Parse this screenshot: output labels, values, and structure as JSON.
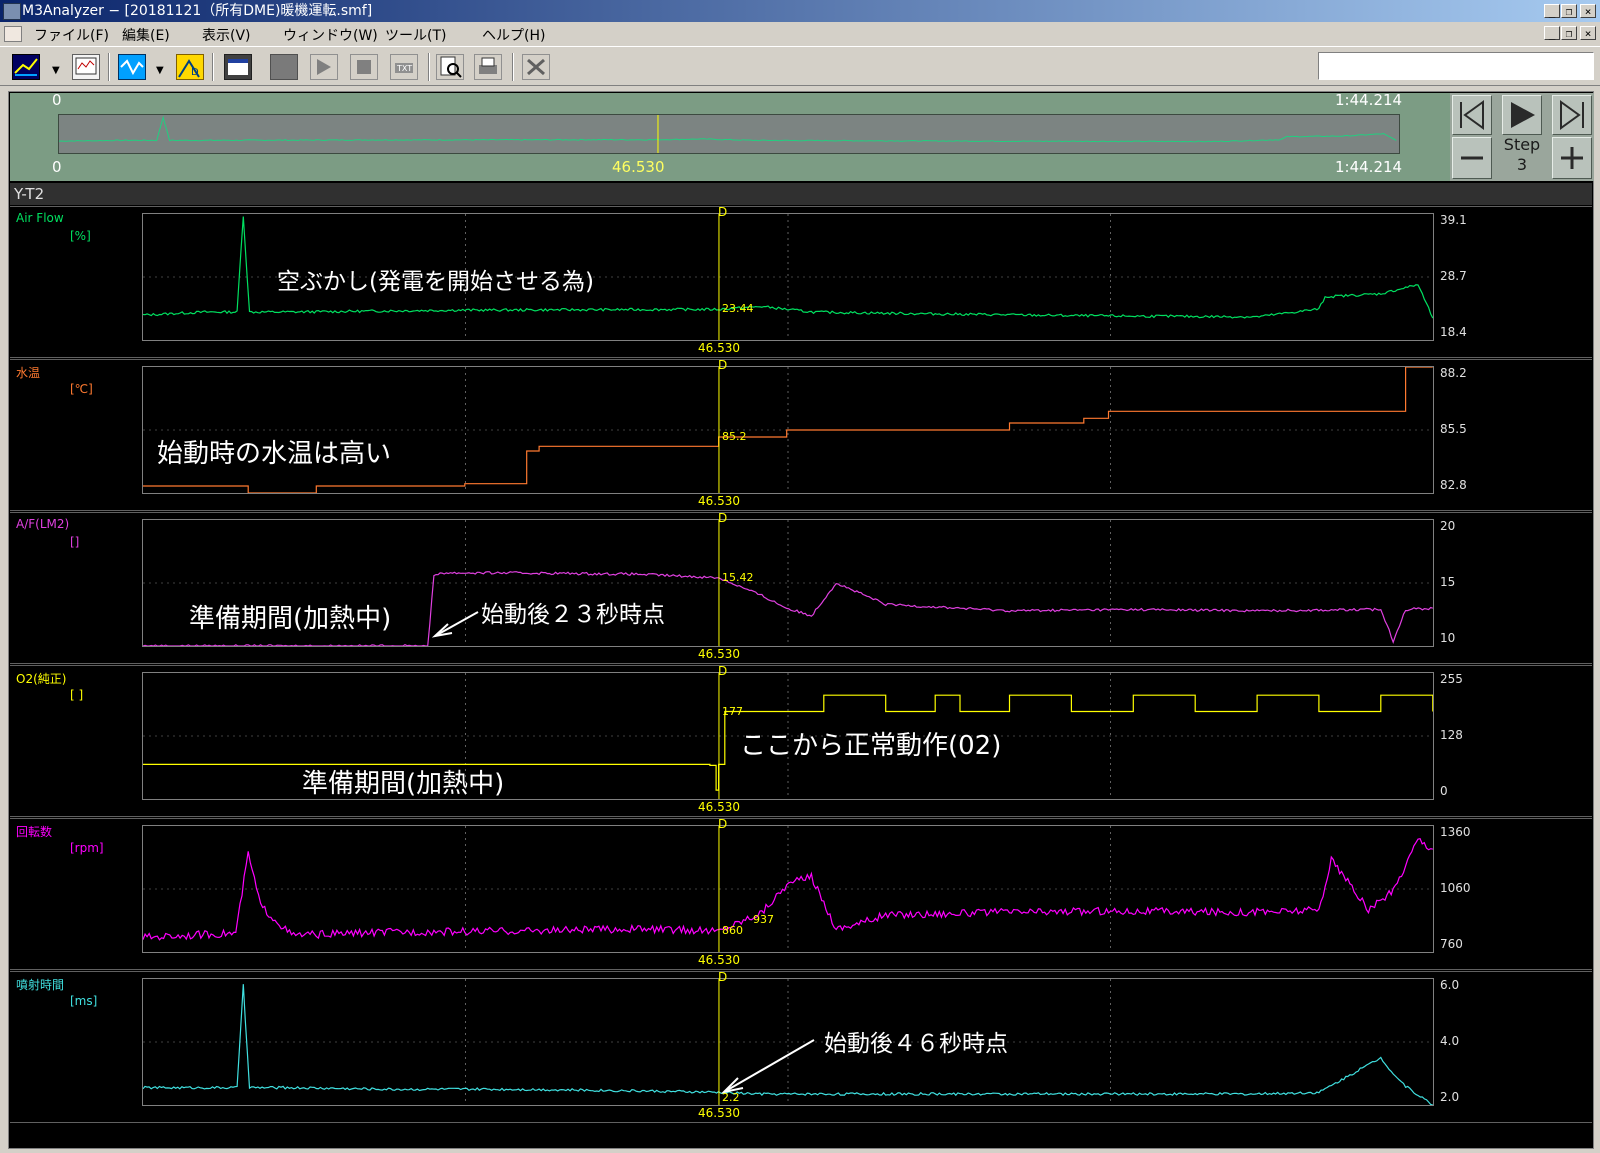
{
  "window": {
    "title": "M3Analyzer − [20181121（所有DME)暖機運転.smf]",
    "controls": [
      "_",
      "❐",
      "×"
    ]
  },
  "menu": {
    "items": [
      "ファイル(F)",
      "編集(E)",
      "表示(V)",
      "ウィンドウ(W)",
      "ツール(T)",
      "ヘルプ(H)"
    ],
    "child_controls": [
      "_",
      "❐",
      "×"
    ]
  },
  "overview": {
    "start_top": "0",
    "end_top": "1:44.214",
    "start_bottom": "0",
    "cursor_time": "46.530",
    "end_bottom": "1:44.214",
    "cursor_fraction": 0.447
  },
  "controls": {
    "step_label": "Step",
    "step_value": "3"
  },
  "view": {
    "name": "Y-T2",
    "cursor_marker": "D",
    "cursor_time": "46.530"
  },
  "panels": [
    {
      "label": "Air Flow",
      "unit": "[%]",
      "color": "#00e060",
      "scale": [
        "39.1",
        "28.7",
        "18.4"
      ],
      "cursor_value": "23.44",
      "annotation": "空ぶかし(発電を開始させる為)"
    },
    {
      "label": "水温",
      "unit": "[℃]",
      "color": "#ff7a30",
      "scale": [
        "88.2",
        "85.5",
        "82.8"
      ],
      "cursor_value": "85.2",
      "annotation": "始動時の水温は高い"
    },
    {
      "label": "A/F(LM2)",
      "unit": "[]",
      "color": "#e040e0",
      "scale": [
        "20",
        "15",
        "10"
      ],
      "cursor_value": "15.42",
      "annotation": "準備期間(加熱中)",
      "annotation2": "始動後２３秒時点"
    },
    {
      "label": "O2(純正)",
      "unit": "[ ]",
      "color": "#ffff00",
      "scale": [
        "255",
        "128",
        "0"
      ],
      "cursor_value": "177",
      "annotation": "準備期間(加熱中)",
      "annotation2": "ここから正常動作(02)"
    },
    {
      "label": "回転数",
      "unit": "[rpm]",
      "color": "#ff00ff",
      "scale": [
        "1360",
        "1060",
        "760"
      ],
      "cursor_value": "860",
      "extra_value": "937"
    },
    {
      "label": "噴射時間",
      "unit": "[ms]",
      "color": "#40e0e0",
      "scale": [
        "6.0",
        "4.0",
        "2.0"
      ],
      "cursor_value": "2.2",
      "annotation": "始動後４６秒時点"
    }
  ],
  "chart_data": {
    "type": "line",
    "x_range_seconds": [
      0,
      104.214
    ],
    "cursor_x": 46.53,
    "series": [
      {
        "name": "Air Flow",
        "unit": "%",
        "ylim": [
          18.4,
          39.1
        ],
        "x": [
          0,
          5,
          7.6,
          8.1,
          8.6,
          12,
          25,
          40,
          46.5,
          50,
          54,
          60,
          75,
          90,
          95,
          95.5,
          100,
          103,
          104.2
        ],
        "y": [
          22.5,
          23.0,
          23.0,
          38.9,
          23.0,
          23.0,
          23.3,
          23.4,
          23.44,
          23.9,
          23.0,
          22.8,
          22.4,
          22.2,
          23.5,
          25.5,
          26.0,
          27.5,
          22.0
        ]
      },
      {
        "name": "水温",
        "unit": "℃",
        "ylim": [
          82.8,
          88.2
        ],
        "x": [
          0,
          7.5,
          8.5,
          11,
          14,
          15.5,
          26,
          31,
          32,
          46.5,
          52,
          60,
          70,
          76,
          78,
          100,
          102,
          104.2
        ],
        "y": [
          83.1,
          83.1,
          82.8,
          82.8,
          83.1,
          83.1,
          83.2,
          84.6,
          84.8,
          85.2,
          85.5,
          85.5,
          85.8,
          86.0,
          86.3,
          86.3,
          88.2,
          88.2
        ]
      },
      {
        "name": "A/F(LM2)",
        "unit": "",
        "ylim": [
          10,
          20
        ],
        "x": [
          0,
          23,
          23.5,
          24,
          30,
          40,
          46.5,
          50,
          52,
          54,
          56,
          60,
          70,
          80,
          90,
          100,
          101,
          102,
          104.2
        ],
        "y": [
          10,
          10,
          15.5,
          15.8,
          15.8,
          15.7,
          15.42,
          14,
          13,
          12.4,
          15,
          13.3,
          12.8,
          12.9,
          12.8,
          12.9,
          10.4,
          12.9,
          13.0
        ]
      },
      {
        "name": "O2(純正)",
        "unit": "",
        "ylim": [
          0,
          255
        ],
        "x": [
          0,
          45,
          45.8,
          46.3,
          46.5,
          47,
          52,
          55,
          60,
          64,
          66,
          70,
          75,
          80,
          85,
          90,
          95,
          100,
          104.2
        ],
        "y": [
          70,
          70,
          68,
          18,
          70,
          177,
          177,
          210,
          177,
          210,
          177,
          210,
          177,
          210,
          177,
          210,
          177,
          210,
          177
        ]
      },
      {
        "name": "回転数",
        "unit": "rpm",
        "ylim": [
          760,
          1360
        ],
        "x": [
          0,
          7.5,
          8.5,
          9.5,
          12,
          20,
          30,
          40,
          46.5,
          50,
          52,
          54,
          56,
          58,
          60,
          70,
          80,
          90,
          95,
          96,
          99,
          101,
          103,
          104.2
        ],
        "y": [
          830,
          850,
          1230,
          980,
          840,
          855,
          860,
          870,
          860,
          950,
          1080,
          1120,
          870,
          900,
          937,
          950,
          955,
          950,
          960,
          1200,
          960,
          1050,
          1300,
          1250
        ]
      },
      {
        "name": "噴射時間",
        "unit": "ms",
        "ylim": [
          2.0,
          6.0
        ],
        "x": [
          0,
          7.6,
          8.1,
          8.6,
          12,
          20,
          30,
          40,
          46.5,
          50,
          60,
          70,
          80,
          90,
          95,
          100,
          101,
          102,
          104.2
        ],
        "y": [
          2.55,
          2.55,
          5.8,
          2.55,
          2.55,
          2.5,
          2.5,
          2.45,
          2.4,
          2.35,
          2.35,
          2.35,
          2.35,
          2.35,
          2.4,
          3.5,
          3.0,
          2.6,
          2.0
        ]
      }
    ]
  }
}
